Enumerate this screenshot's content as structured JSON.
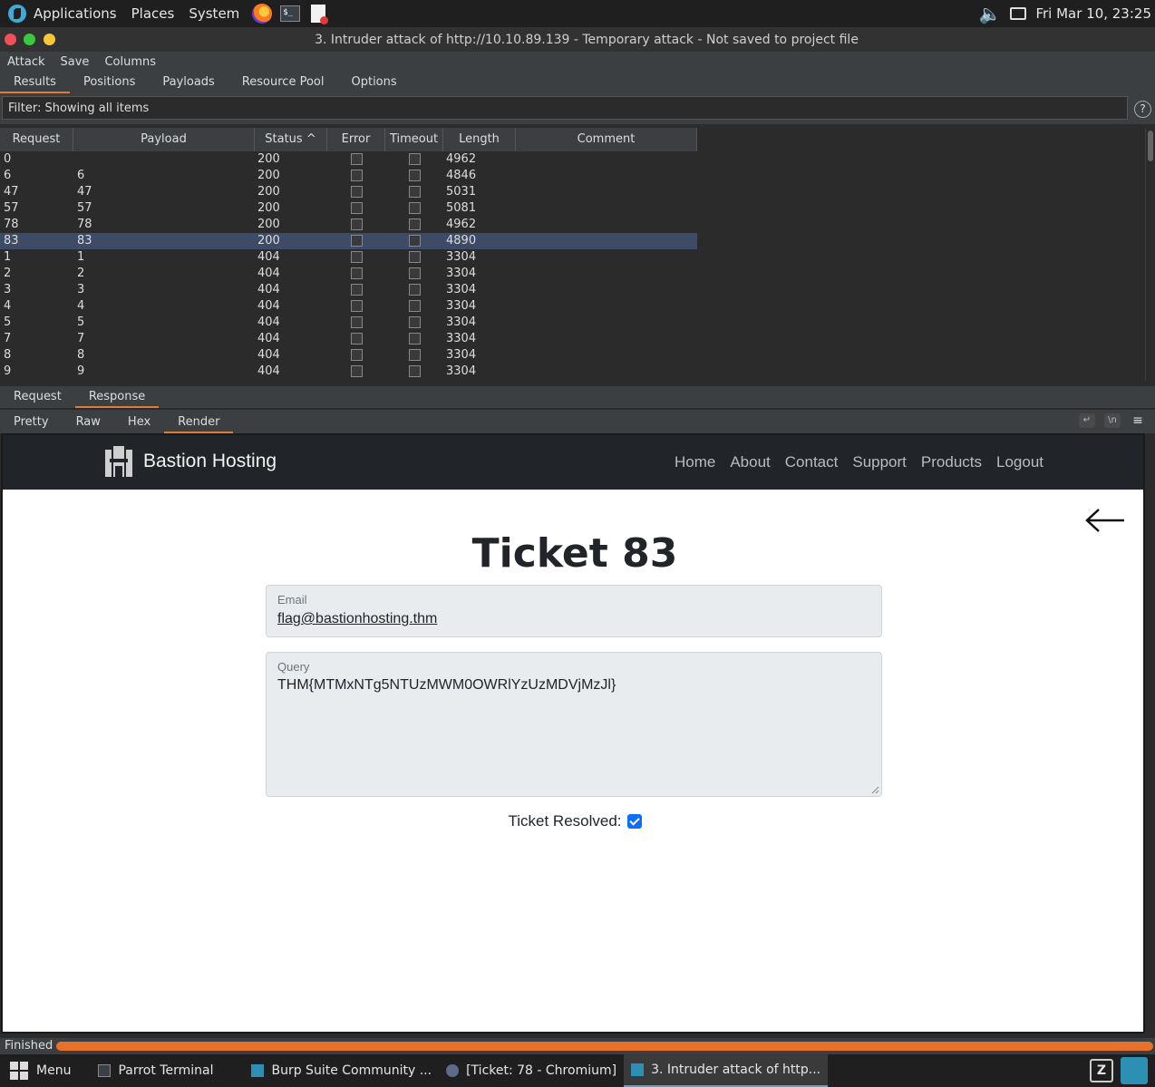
{
  "sysbar": {
    "applications": "Applications",
    "places": "Places",
    "system": "System",
    "datetime": "Fri Mar 10, 23:25"
  },
  "window": {
    "title": "3. Intruder attack of http://10.10.89.139 - Temporary attack - Not saved to project file"
  },
  "menubar": {
    "attack": "Attack",
    "save": "Save",
    "columns": "Columns"
  },
  "tabs": {
    "results": "Results",
    "positions": "Positions",
    "payloads": "Payloads",
    "resource_pool": "Resource Pool",
    "options": "Options"
  },
  "filter": {
    "text": "Filter: Showing all items",
    "help": "?"
  },
  "table": {
    "headers": {
      "request": "Request",
      "payload": "Payload",
      "status": "Status ^",
      "error": "Error",
      "timeout": "Timeout",
      "length": "Length",
      "comment": "Comment"
    },
    "rows": [
      {
        "request": "0",
        "payload": "",
        "status": "200",
        "length": "4962"
      },
      {
        "request": "6",
        "payload": "6",
        "status": "200",
        "length": "4846"
      },
      {
        "request": "47",
        "payload": "47",
        "status": "200",
        "length": "5031"
      },
      {
        "request": "57",
        "payload": "57",
        "status": "200",
        "length": "5081"
      },
      {
        "request": "78",
        "payload": "78",
        "status": "200",
        "length": "4962"
      },
      {
        "request": "83",
        "payload": "83",
        "status": "200",
        "length": "4890"
      },
      {
        "request": "1",
        "payload": "1",
        "status": "404",
        "length": "3304"
      },
      {
        "request": "2",
        "payload": "2",
        "status": "404",
        "length": "3304"
      },
      {
        "request": "3",
        "payload": "3",
        "status": "404",
        "length": "3304"
      },
      {
        "request": "4",
        "payload": "4",
        "status": "404",
        "length": "3304"
      },
      {
        "request": "5",
        "payload": "5",
        "status": "404",
        "length": "3304"
      },
      {
        "request": "7",
        "payload": "7",
        "status": "404",
        "length": "3304"
      },
      {
        "request": "8",
        "payload": "8",
        "status": "404",
        "length": "3304"
      },
      {
        "request": "9",
        "payload": "9",
        "status": "404",
        "length": "3304"
      }
    ],
    "selected_request": "83"
  },
  "rrtabs": {
    "request": "Request",
    "response": "Response"
  },
  "viewtabs": {
    "pretty": "Pretty",
    "raw": "Raw",
    "hex": "Hex",
    "render": "Render"
  },
  "site": {
    "brand": "Bastion Hosting",
    "nav": [
      "Home",
      "About",
      "Contact",
      "Support",
      "Products",
      "Logout"
    ],
    "ticket_title": "Ticket 83",
    "email_label": "Email",
    "email_value": "flag@bastionhosting.thm",
    "query_label": "Query",
    "query_value": "THM{MTMxNTg5NTUzMWM0OWRlYzUzMDVjMzJl}",
    "resolved_label": "Ticket Resolved:",
    "resolved_checked": true
  },
  "status": {
    "text": "Finished",
    "progress": 1.0
  },
  "taskbar": {
    "menu": "Menu",
    "items": [
      "Parrot Terminal",
      "Burp Suite Community ...",
      "[Ticket: 78 - Chromium]",
      "3. Intruder attack of http..."
    ]
  },
  "colors": {
    "accent": "#e07a3a",
    "selection": "#3d4b66",
    "bootstrap_primary": "#0d6efd"
  }
}
